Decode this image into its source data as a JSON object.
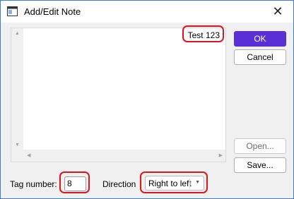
{
  "window": {
    "title": "Add/Edit Note",
    "close_glyph": "✕"
  },
  "editor": {
    "text": "Test 123"
  },
  "buttons": {
    "ok": "OK",
    "cancel": "Cancel",
    "open": "Open...",
    "save": "Save..."
  },
  "footer": {
    "tag_label": "Tag number:",
    "tag_value": "8",
    "direction_label": "Direction",
    "direction_value": "Right to left"
  },
  "colors": {
    "accent": "#5b2fd6",
    "highlight": "#e0141e",
    "window_border": "#3b7ad8"
  }
}
